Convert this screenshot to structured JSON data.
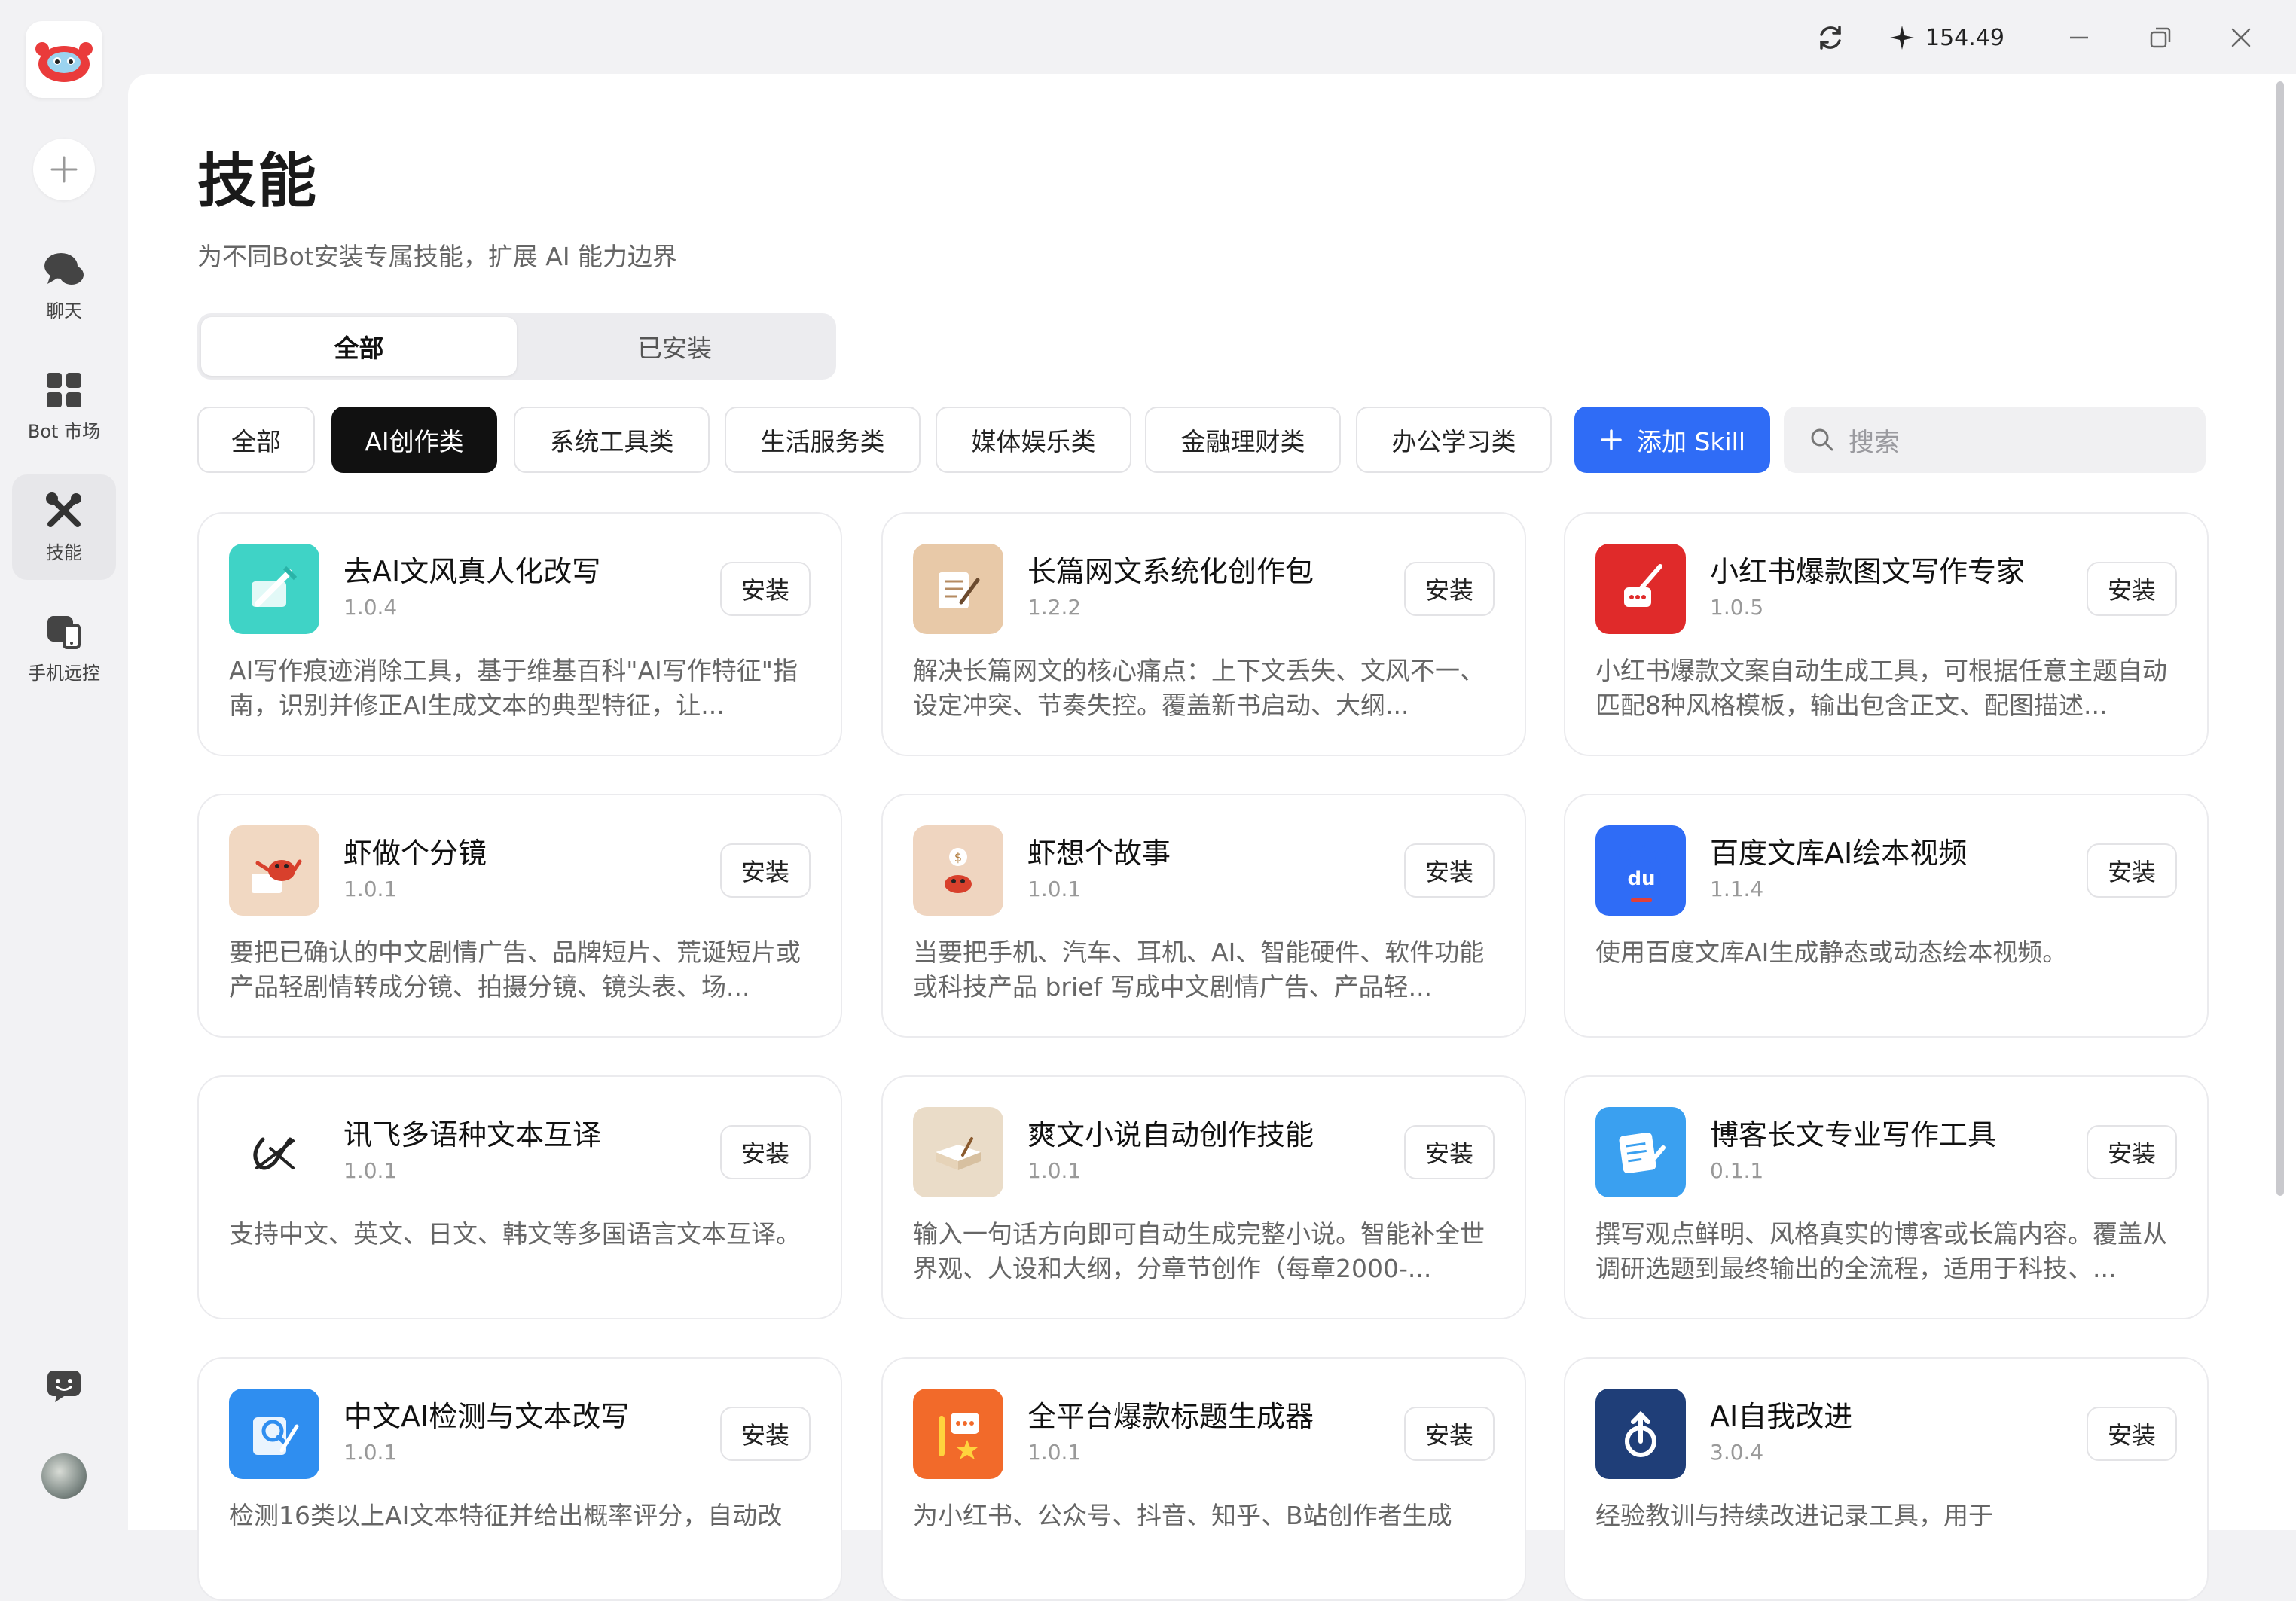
{
  "titlebar": {
    "credits": "154.49"
  },
  "rail": {
    "items": [
      {
        "label": "聊天",
        "icon": "chat-bubbles-icon"
      },
      {
        "label": "Bot 市场",
        "icon": "grid-apps-icon"
      },
      {
        "label": "技能",
        "icon": "tools-icon"
      },
      {
        "label": "手机远控",
        "icon": "phone-remote-icon"
      }
    ]
  },
  "header": {
    "title": "技能",
    "subtitle": "为不同Bot安装专属技能，扩展 AI 能力边界"
  },
  "tabs": [
    "全部",
    "已安装"
  ],
  "categories": [
    "全部",
    "AI创作类",
    "系统工具类",
    "生活服务类",
    "媒体娱乐类",
    "金融理财类",
    "办公学习类"
  ],
  "add_button": "添加 Skill",
  "search": {
    "placeholder": "搜索"
  },
  "install_label": "安装",
  "skills": [
    {
      "name": "去AI文风真人化改写",
      "version": "1.0.4",
      "desc": "AI写作痕迹消除工具，基于维基百科\"AI写作特征\"指南，识别并修正AI生成文本的典型特征，让...",
      "color": "#3fd3c6"
    },
    {
      "name": "长篇网文系统化创作包",
      "version": "1.2.2",
      "desc": "解决长篇网文的核心痛点：上下文丢失、文风不一、设定冲突、节奏失控。覆盖新书启动、大纲...",
      "color": "#e8c9a8"
    },
    {
      "name": "小红书爆款图文写作专家",
      "version": "1.0.5",
      "desc": "小红书爆款文案自动生成工具，可根据任意主题自动匹配8种风格模板，输出包含正文、配图描述...",
      "color": "#e02a2a"
    },
    {
      "name": "虾做个分镜",
      "version": "1.0.1",
      "desc": "要把已确认的中文剧情广告、品牌短片、荒诞短片或产品轻剧情转成分镜、拍摄分镜、镜头表、场...",
      "color": "#f1d8c2"
    },
    {
      "name": "虾想个故事",
      "version": "1.0.1",
      "desc": "当要把手机、汽车、耳机、AI、智能硬件、软件功能或科技产品 brief 写成中文剧情广告、产品轻...",
      "color": "#efd5c0"
    },
    {
      "name": "百度文库AI绘本视频",
      "version": "1.1.4",
      "desc": "使用百度文库AI生成静态或动态绘本视频。",
      "color": "#2f6cf6"
    },
    {
      "name": "讯飞多语种文本互译",
      "version": "1.0.1",
      "desc": "支持中文、英文、日文、韩文等多国语言文本互译。",
      "color": "#ffffff"
    },
    {
      "name": "爽文小说自动创作技能",
      "version": "1.0.1",
      "desc": "输入一句话方向即可自动生成完整小说。智能补全世界观、人设和大纲，分章节创作（每章2000-...",
      "color": "#eadcc8"
    },
    {
      "name": "博客长文专业写作工具",
      "version": "0.1.1",
      "desc": "撰写观点鲜明、风格真实的博客或长篇内容。覆盖从调研选题到最终输出的全流程，适用于科技、...",
      "color": "#3aa0f0"
    },
    {
      "name": "中文AI检测与文本改写",
      "version": "1.0.1",
      "desc": "检测16类以上AI文本特征并给出概率评分，自动改",
      "color": "#2f8ef0"
    },
    {
      "name": "全平台爆款标题生成器",
      "version": "1.0.1",
      "desc": "为小红书、公众号、抖音、知乎、B站创作者生成",
      "color": "#f26a2a"
    },
    {
      "name": "AI自我改进",
      "version": "3.0.4",
      "desc": "经验教训与持续改进记录工具，用于",
      "color": "#1f3e78"
    }
  ]
}
